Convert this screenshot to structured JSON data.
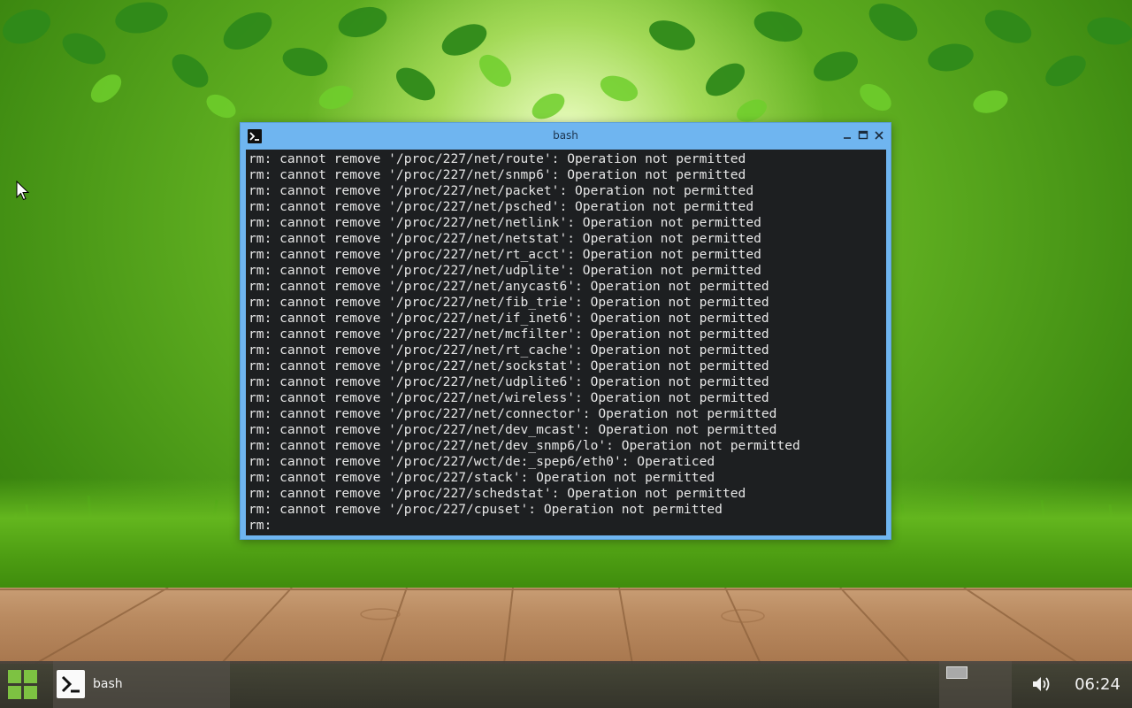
{
  "window": {
    "title": "bash",
    "buttons": {
      "minimize": "minimize",
      "maximize": "maximize",
      "close": "close"
    }
  },
  "terminal": {
    "lines": [
      "rm: cannot remove '/proc/227/net/route': Operation not permitted",
      "rm: cannot remove '/proc/227/net/snmp6': Operation not permitted",
      "rm: cannot remove '/proc/227/net/packet': Operation not permitted",
      "rm: cannot remove '/proc/227/net/psched': Operation not permitted",
      "rm: cannot remove '/proc/227/net/netlink': Operation not permitted",
      "rm: cannot remove '/proc/227/net/netstat': Operation not permitted",
      "rm: cannot remove '/proc/227/net/rt_acct': Operation not permitted",
      "rm: cannot remove '/proc/227/net/udplite': Operation not permitted",
      "rm: cannot remove '/proc/227/net/anycast6': Operation not permitted",
      "rm: cannot remove '/proc/227/net/fib_trie': Operation not permitted",
      "rm: cannot remove '/proc/227/net/if_inet6': Operation not permitted",
      "rm: cannot remove '/proc/227/net/mcfilter': Operation not permitted",
      "rm: cannot remove '/proc/227/net/rt_cache': Operation not permitted",
      "rm: cannot remove '/proc/227/net/sockstat': Operation not permitted",
      "rm: cannot remove '/proc/227/net/udplite6': Operation not permitted",
      "rm: cannot remove '/proc/227/net/wireless': Operation not permitted",
      "rm: cannot remove '/proc/227/net/connector': Operation not permitted",
      "rm: cannot remove '/proc/227/net/dev_mcast': Operation not permitted",
      "rm: cannot remove '/proc/227/net/dev_snmp6/lo': Operation not permitted",
      "rm: cannot remove '/proc/227/wct/de:_spep6/eth0': Operaticed",
      "rm: cannot remove '/proc/227/stack': Operation not permitted",
      "rm: cannot remove '/proc/227/schedstat': Operation not permitted",
      "rm: cannot remove '/proc/227/cpuset': Operation not permitted",
      "rm:"
    ]
  },
  "taskbar": {
    "start_icon": "grid-icon",
    "task_label": "bash",
    "task_icon": "terminal-icon",
    "volume_icon": "speaker-icon",
    "clock": "06:24"
  },
  "colors": {
    "titlebar": "#6fb5f0",
    "terminal_bg": "#1d1f21",
    "terminal_fg": "#e6e6e6",
    "start_green": "#7dc242"
  }
}
